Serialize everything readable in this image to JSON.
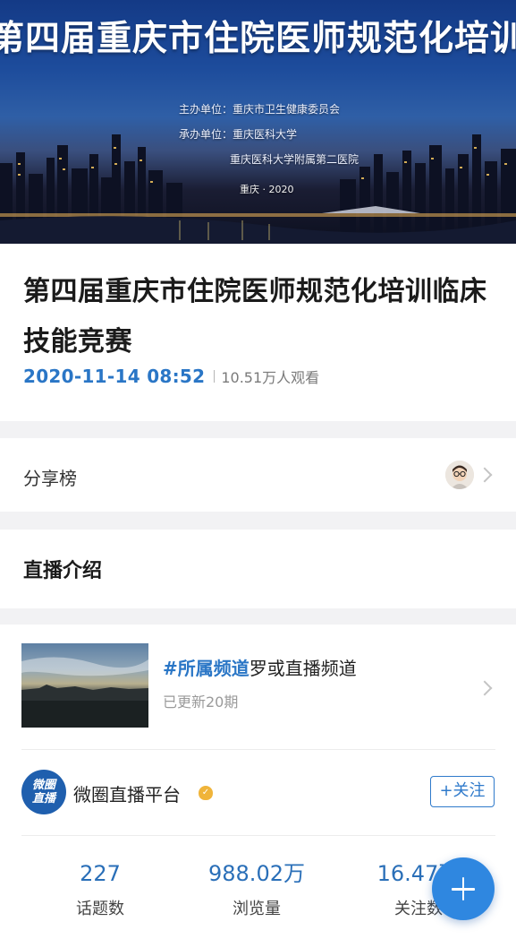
{
  "banner": {
    "title": "第四届重庆市住院医师规范化培训临床技能竞",
    "organizers": [
      "主办单位：重庆市卫生健康委员会",
      "承办单位：重庆医科大学",
      "重庆医科大学附属第二医院"
    ],
    "place_year": "重庆 · 2020"
  },
  "live": {
    "title": "第四届重庆市住院医师规范化培训临床技能竞赛",
    "time": "2020-11-14 08:52",
    "views": "10.51万人观看"
  },
  "share": {
    "label": "分享榜"
  },
  "intro": {
    "label": "直播介绍"
  },
  "channel": {
    "tag": "#所属频道",
    "name": "罗或直播频道",
    "updates": "已更新20期"
  },
  "platform": {
    "logo_line1": "微圈",
    "logo_line2": "直播",
    "name": "微圈直播平台",
    "follow_label": "+关注"
  },
  "stats": [
    {
      "value": "227",
      "label": "话题数"
    },
    {
      "value": "988.02万",
      "label": "浏览量"
    },
    {
      "value": "16.47万",
      "label": "关注数"
    }
  ],
  "fab": {
    "icon": "plus-icon"
  },
  "colors": {
    "accent": "#2a76c6",
    "fab": "#2f87e0",
    "verified": "#f0b43a",
    "page_bg": "#f2f2f4"
  }
}
